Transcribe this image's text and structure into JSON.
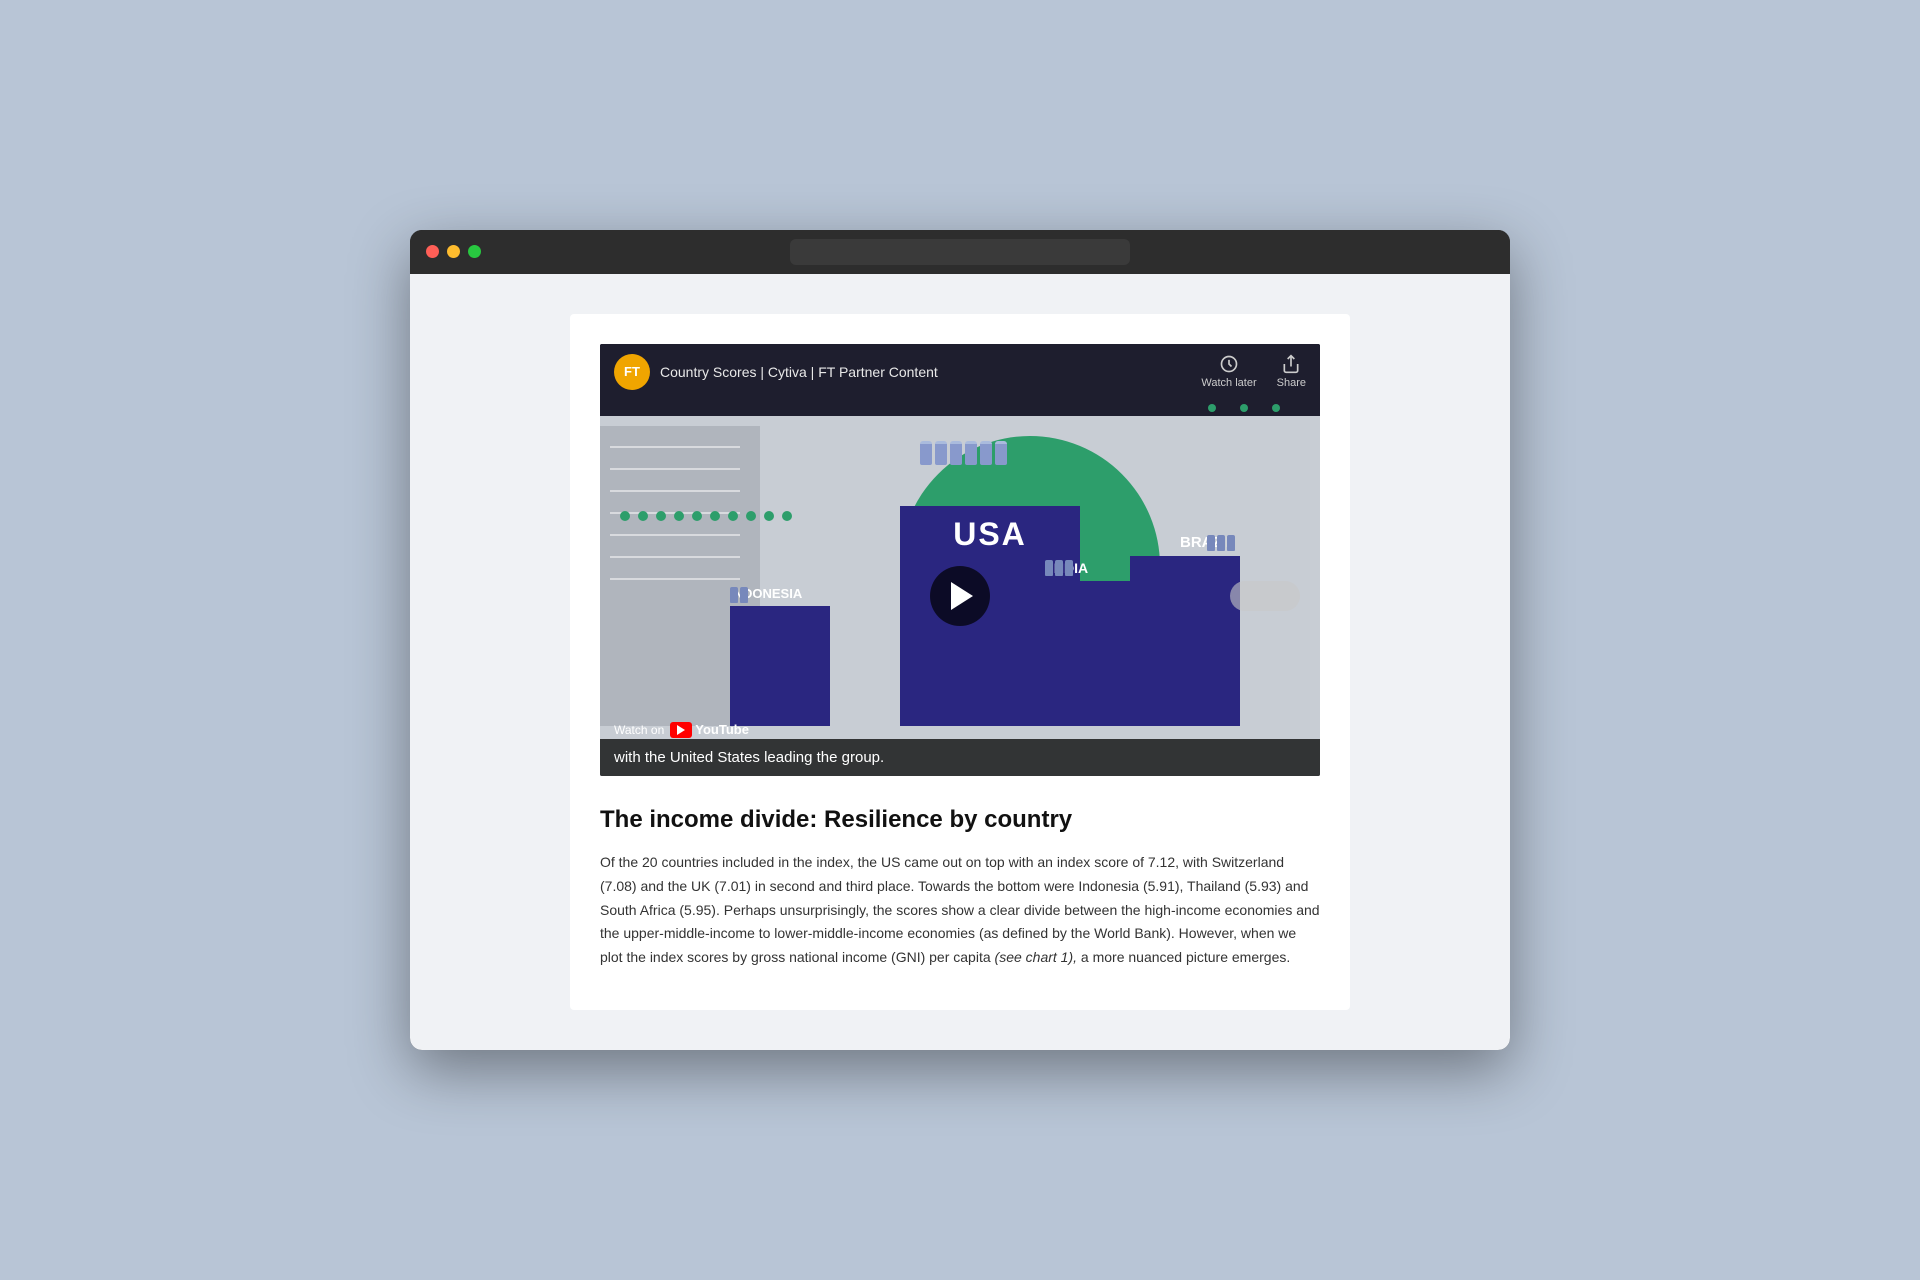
{
  "browser": {
    "titlebar": {
      "close_label": "close",
      "minimize_label": "minimize",
      "maximize_label": "maximize"
    }
  },
  "video": {
    "channel_logo": "FT",
    "title": "Country Scores | Cytiva | FT Partner Content",
    "watch_later_label": "Watch later",
    "share_label": "Share",
    "subtitle": "with the United States leading the group.",
    "watch_on_label": "Watch on",
    "youtube_label": "YouTube",
    "play_label": "Play",
    "bars": [
      {
        "label": "USA"
      },
      {
        "label": "INDIA"
      },
      {
        "label": "INDONESIA"
      },
      {
        "label": "BRAZIL"
      }
    ],
    "dots_count": 3
  },
  "article": {
    "title": "The income divide: Resilience by country",
    "body": "Of the 20 countries included in the index, the US came out on top with an index score of 7.12, with Switzerland (7.08) and the UK (7.01) in second and third place. Towards the bottom were Indonesia (5.91), Thailand (5.93) and South Africa (5.95). Perhaps unsurprisingly, the scores show a clear divide between the high-income economies and the upper-middle-income to lower-middle-income economies (as defined by the World Bank). However, when we plot the index scores by gross national income (GNI) per capita ",
    "body_italic": "(see chart 1),",
    "body_end": " a more nuanced picture emerges."
  }
}
